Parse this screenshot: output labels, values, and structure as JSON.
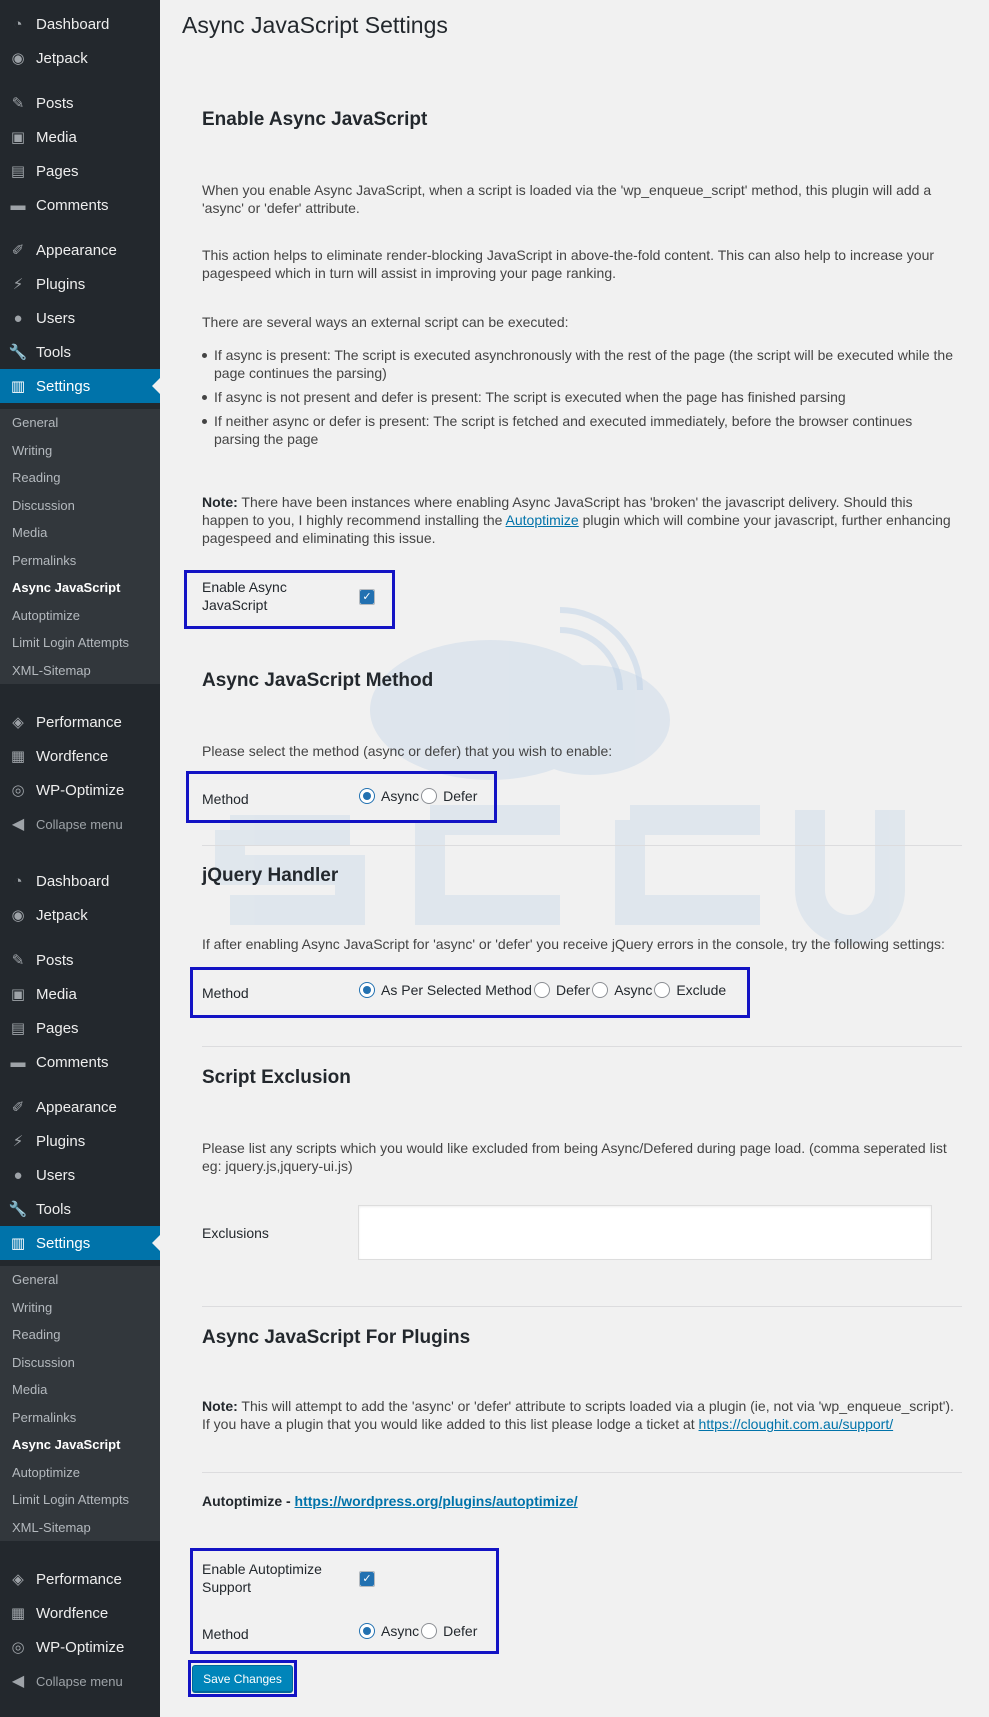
{
  "sidebar": {
    "top_group_1": [
      {
        "label": "Dashboard",
        "icon": "dashboard-icon"
      },
      {
        "label": "Jetpack",
        "icon": "jetpack-icon"
      }
    ],
    "top_group_2": [
      {
        "label": "Posts",
        "icon": "pin-icon"
      },
      {
        "label": "Media",
        "icon": "media-icon"
      },
      {
        "label": "Pages",
        "icon": "pages-icon"
      },
      {
        "label": "Comments",
        "icon": "comment-icon"
      }
    ],
    "top_group_3": [
      {
        "label": "Appearance",
        "icon": "brush-icon"
      },
      {
        "label": "Plugins",
        "icon": "plug-icon"
      },
      {
        "label": "Users",
        "icon": "user-icon"
      },
      {
        "label": "Tools",
        "icon": "wrench-icon"
      },
      {
        "label": "Settings",
        "icon": "settings-icon"
      }
    ],
    "submenu": [
      "General",
      "Writing",
      "Reading",
      "Discussion",
      "Media",
      "Permalinks",
      "Async JavaScript",
      "Autoptimize",
      "Limit Login Attempts",
      "XML-Sitemap"
    ],
    "bottom_group": [
      {
        "label": "Performance",
        "icon": "performance-icon"
      },
      {
        "label": "Wordfence",
        "icon": "wordfence-icon"
      },
      {
        "label": "WP-Optimize",
        "icon": "wp-optimize-icon"
      }
    ],
    "collapse_label": "Collapse menu"
  },
  "page": {
    "title": "Async JavaScript Settings",
    "enable_section": {
      "heading": "Enable Async JavaScript",
      "para1": "When you enable Async JavaScript, when a script is loaded via the 'wp_enqueue_script' method, this plugin will add a 'async' or 'defer' attribute.",
      "para2": "This action helps to eliminate render-blocking JavaScript in above-the-fold content. This can also help to increase your pagespeed which in turn will assist in improving your page ranking.",
      "para3": "There are several ways an external script can be executed:",
      "bullets": [
        "If async is present: The script is executed asynchronously with the rest of the page (the script will be executed while the page continues the parsing)",
        "If async is not present and defer is present: The script is executed when the page has finished parsing",
        "If neither async or defer is present: The script is fetched and executed immediately, before the browser continues parsing the page"
      ],
      "note_label": "Note:",
      "note_text_1": " There have been instances where enabling Async JavaScript has 'broken' the javascript delivery. Should this happen to you, I highly recommend installing the ",
      "note_link": "Autoptimize",
      "note_text_2": " plugin which will combine your javascript, further enhancing pagespeed and eliminating this issue.",
      "field_label": "Enable Async JavaScript",
      "checked": true
    },
    "method_section": {
      "heading": "Async JavaScript Method",
      "para": "Please select the method (async or defer) that you wish to enable:",
      "field_label": "Method",
      "options": [
        "Async",
        "Defer"
      ],
      "selected": "Async"
    },
    "jquery_section": {
      "heading": "jQuery Handler",
      "para": "If after enabling Async JavaScript for 'async' or 'defer' you receive jQuery errors in the console, try the following settings:",
      "field_label": "Method",
      "options": [
        "As Per Selected Method",
        "Defer",
        "Async",
        "Exclude"
      ],
      "selected": "As Per Selected Method"
    },
    "exclusion_section": {
      "heading": "Script Exclusion",
      "para": "Please list any scripts which you would like excluded from being Async/Defered during page load. (comma seperated list eg: jquery.js,jquery-ui.js)",
      "field_label": "Exclusions",
      "value": ""
    },
    "plugins_section": {
      "heading": "Async JavaScript For Plugins",
      "note_label": "Note:",
      "note_text": " This will attempt to add the 'async' or 'defer' attribute to scripts loaded via a plugin (ie, not via 'wp_enqueue_script'). If you have a plugin that you would like added to this list please lodge a ticket at ",
      "note_link": "https://cloughit.com.au/support/",
      "autoptimize_label": "Autoptimize - ",
      "autoptimize_link": "https://wordpress.org/plugins/autoptimize/",
      "enable_label": "Enable Autoptimize Support",
      "enable_checked": true,
      "method_label": "Method",
      "options": [
        "Async",
        "Defer"
      ],
      "selected": "Async"
    },
    "save_label": "Save Changes"
  },
  "colors": {
    "sidebar_bg": "#23282d",
    "submenu_bg": "#32373c",
    "accent": "#0073aa",
    "highlight_box": "#1313c4"
  }
}
